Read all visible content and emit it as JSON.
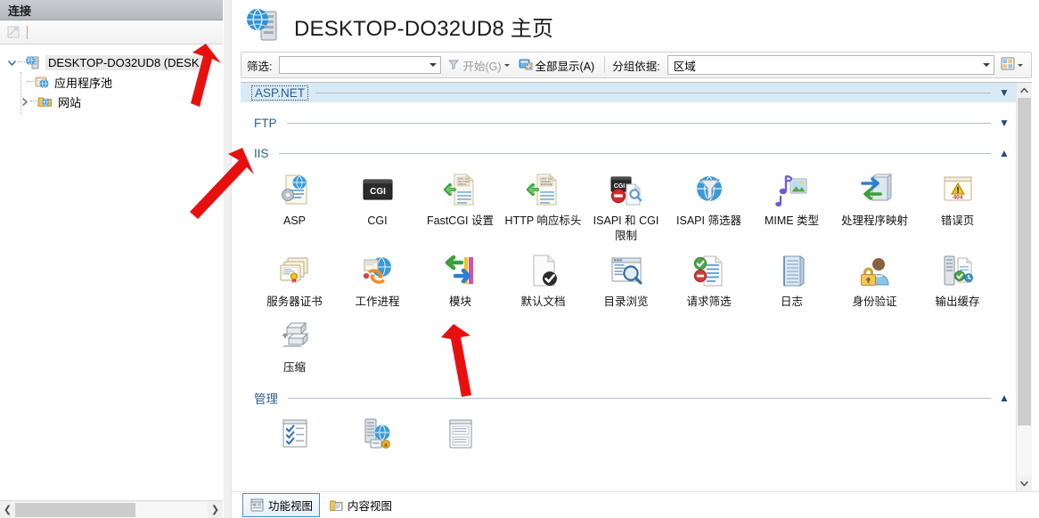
{
  "sidebar": {
    "header": "连接",
    "toolbar": {
      "icon": "connect-disabled-icon"
    },
    "tree": [
      {
        "label": "DESKTOP-DO32UD8 (DESK",
        "icon": "server-icon",
        "twisty": "expanded",
        "selected": true
      },
      {
        "label": "应用程序池",
        "icon": "app-pool-icon",
        "twisty": "none",
        "selected": false
      },
      {
        "label": "网站",
        "icon": "sites-folder-icon",
        "twisty": "collapsed",
        "selected": false
      }
    ],
    "hscroll": {
      "left": "scroll-left-arrow",
      "right": "scroll-right-arrow"
    }
  },
  "page": {
    "title": "DESKTOP-DO32UD8 主页",
    "icon": "server-home-icon"
  },
  "filter_bar": {
    "filter_label": "筛选:",
    "filter_value": "",
    "filter_placeholder": "",
    "start_label": "开始(G)",
    "show_all_label": "全部显示(A)",
    "group_by_label": "分组依据:",
    "group_by_value": "区域",
    "view_icon": "view-mode-icon"
  },
  "sections": [
    {
      "id": "aspnet",
      "title": "ASP.NET",
      "state": "collapsed",
      "chevron": "▼",
      "highlighted": true,
      "focused": true,
      "items": []
    },
    {
      "id": "ftp",
      "title": "FTP",
      "state": "collapsed",
      "chevron": "▼",
      "highlighted": false,
      "focused": false,
      "items": []
    },
    {
      "id": "iis",
      "title": "IIS",
      "state": "expanded",
      "chevron": "▲",
      "highlighted": false,
      "focused": false,
      "items": [
        {
          "label": "ASP",
          "icon": "asp-icon"
        },
        {
          "label": "CGI",
          "icon": "cgi-icon"
        },
        {
          "label": "FastCGI 设置",
          "icon": "fastcgi-settings-icon"
        },
        {
          "label": "HTTP 响应标头",
          "icon": "http-response-headers-icon"
        },
        {
          "label": "ISAPI 和 CGI 限制",
          "icon": "isapi-cgi-restrictions-icon"
        },
        {
          "label": "ISAPI 筛选器",
          "icon": "isapi-filters-icon"
        },
        {
          "label": "MIME 类型",
          "icon": "mime-types-icon"
        },
        {
          "label": "处理程序映射",
          "icon": "handler-mappings-icon"
        },
        {
          "label": "错误页",
          "icon": "error-pages-icon"
        },
        {
          "label": "服务器证书",
          "icon": "server-certificates-icon"
        },
        {
          "label": "工作进程",
          "icon": "worker-processes-icon"
        },
        {
          "label": "模块",
          "icon": "modules-icon"
        },
        {
          "label": "默认文档",
          "icon": "default-document-icon"
        },
        {
          "label": "目录浏览",
          "icon": "directory-browsing-icon"
        },
        {
          "label": "请求筛选",
          "icon": "request-filtering-icon"
        },
        {
          "label": "日志",
          "icon": "logging-icon"
        },
        {
          "label": "身份验证",
          "icon": "authentication-icon"
        },
        {
          "label": "输出缓存",
          "icon": "output-caching-icon"
        },
        {
          "label": "压缩",
          "icon": "compression-icon"
        }
      ]
    },
    {
      "id": "management",
      "title": "管理",
      "state": "expanded",
      "chevron": "▲",
      "highlighted": false,
      "focused": false,
      "items": [
        {
          "label": "",
          "icon": "configuration-editor-icon"
        },
        {
          "label": "",
          "icon": "shared-configuration-icon"
        },
        {
          "label": "",
          "icon": "feature-delegation-icon"
        }
      ]
    }
  ],
  "tabs": [
    {
      "label": "功能视图",
      "icon": "features-view-icon",
      "active": true
    },
    {
      "label": "内容视图",
      "icon": "content-view-icon",
      "active": false
    }
  ],
  "colors": {
    "section_title": "#2e5d8e",
    "highlight_row": "#d9eaf7",
    "annotation_arrow": "#e8100f",
    "sidebar_header": "#bfc2c7"
  },
  "annotations": [
    {
      "name": "arrow-to-tree-root",
      "color": "#e8100f"
    },
    {
      "name": "arrow-to-iis-section",
      "color": "#e8100f"
    },
    {
      "name": "arrow-to-modules",
      "color": "#e8100f"
    }
  ]
}
